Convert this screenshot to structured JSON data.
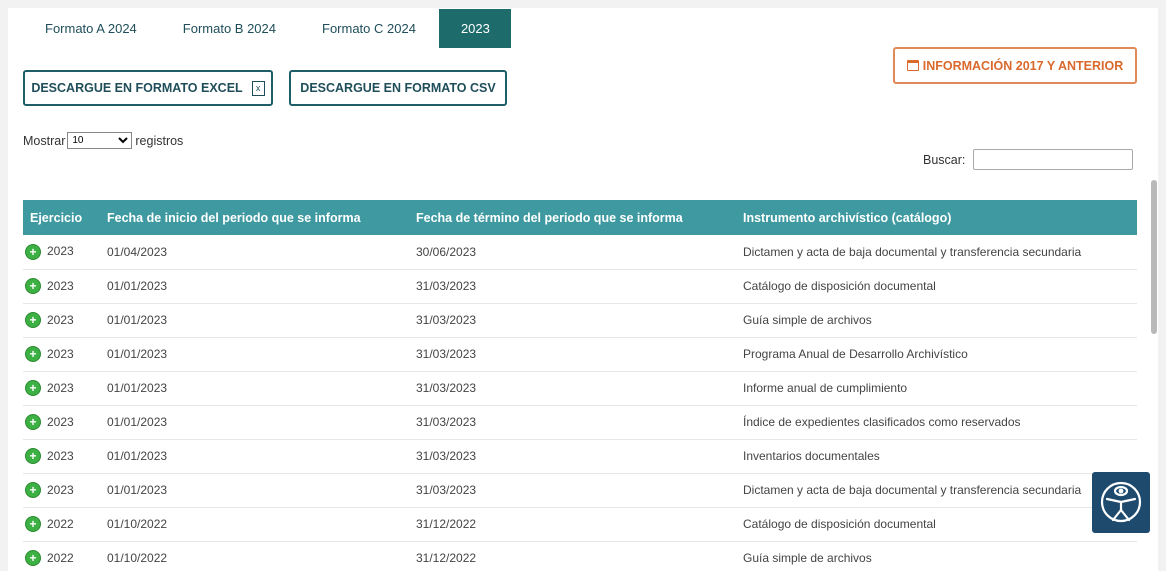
{
  "tabs": [
    {
      "label": "Formato A 2024"
    },
    {
      "label": "Formato B 2024"
    },
    {
      "label": "Formato C 2024"
    },
    {
      "label": "2023",
      "active": true
    }
  ],
  "buttons": {
    "excel": "DESCARGUE EN FORMATO EXCEL",
    "csv": "DESCARGUE EN FORMATO CSV",
    "info": "INFORMACIÓN 2017 Y ANTERIOR"
  },
  "length": {
    "prefix": "Mostrar",
    "value": "10",
    "suffix": "registros"
  },
  "search": {
    "label": "Buscar:",
    "value": ""
  },
  "table": {
    "headers": [
      "Ejercicio",
      "Fecha de inicio del periodo que se informa",
      "Fecha de término del periodo que se informa",
      "Instrumento archivístico (catálogo)"
    ],
    "rows": [
      [
        "2023",
        "01/04/2023",
        "30/06/2023",
        "Dictamen y acta de baja documental y transferencia secundaria"
      ],
      [
        "2023",
        "01/01/2023",
        "31/03/2023",
        "Catálogo de disposición documental"
      ],
      [
        "2023",
        "01/01/2023",
        "31/03/2023",
        "Guía simple de archivos"
      ],
      [
        "2023",
        "01/01/2023",
        "31/03/2023",
        "Programa Anual de Desarrollo Archivístico"
      ],
      [
        "2023",
        "01/01/2023",
        "31/03/2023",
        "Informe anual de cumplimiento"
      ],
      [
        "2023",
        "01/01/2023",
        "31/03/2023",
        "Índice de expedientes clasificados como reservados"
      ],
      [
        "2023",
        "01/01/2023",
        "31/03/2023",
        "Inventarios documentales"
      ],
      [
        "2023",
        "01/01/2023",
        "31/03/2023",
        "Dictamen y acta de baja documental y transferencia secundaria"
      ],
      [
        "2022",
        "01/10/2022",
        "31/12/2022",
        "Catálogo de disposición documental"
      ],
      [
        "2022",
        "01/10/2022",
        "31/12/2022",
        "Guía simple de archivos"
      ]
    ]
  },
  "icons": {
    "expand": "plus-circle-icon",
    "excel": "excel-file-icon",
    "calendar": "calendar-icon",
    "accessibility": "accessibility-icon"
  },
  "colors": {
    "header": "#3e9aa0",
    "tab_active": "#1e6b6c",
    "info_accent": "#d9692d",
    "expand": "#3cb043"
  }
}
